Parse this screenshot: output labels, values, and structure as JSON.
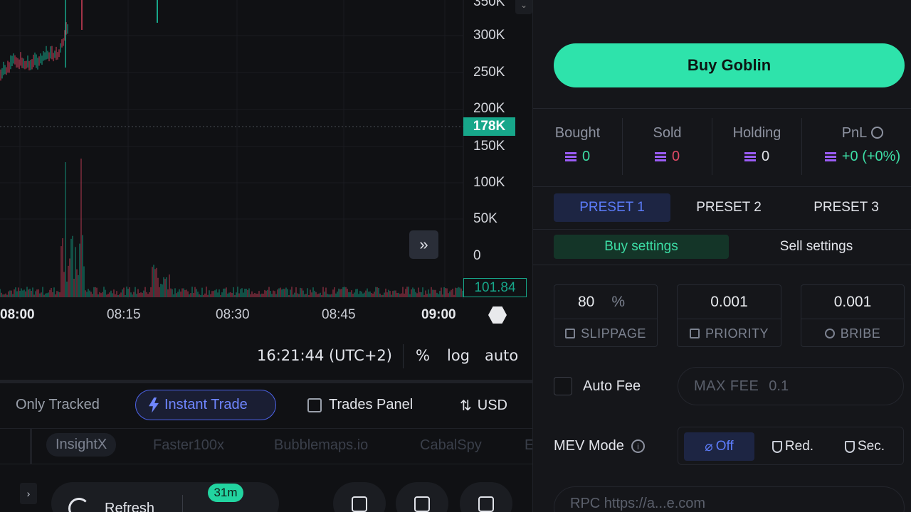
{
  "chart": {
    "price_axis": [
      "350K",
      "300K",
      "250K",
      "200K",
      "150K",
      "100K",
      "50K",
      "0"
    ],
    "current_price_badge": "178K",
    "volume_badge": "101.84",
    "time_axis": [
      {
        "label": "08:00",
        "bold": true
      },
      {
        "label": "08:15",
        "bold": false
      },
      {
        "label": "08:30",
        "bold": false
      },
      {
        "label": "08:45",
        "bold": false
      },
      {
        "label": "09:00",
        "bold": true
      }
    ],
    "scroll_glyph": "»",
    "colors": {
      "up": "#17a78a",
      "down": "#d2405a",
      "accent": "#2ee3ab"
    }
  },
  "chart_footer": {
    "clock": "16:21:44 (UTC+2)",
    "percent": "%",
    "log": "log",
    "auto": "auto"
  },
  "filters": {
    "only_tracked": "Only Tracked",
    "instant_trade": "Instant Trade",
    "trades_panel": "Trades Panel",
    "currency": "USD"
  },
  "apps": {
    "items": [
      "InsightX",
      "Faster100x",
      "Bubblemaps.io",
      "CabalSpy",
      "E"
    ]
  },
  "bottom_bar": {
    "refresh": "Refresh",
    "timer": "31m"
  },
  "trade": {
    "buy_label": "Buy Goblin",
    "stats": [
      {
        "label": "Bought",
        "value": "0",
        "color": "#3ddfa6"
      },
      {
        "label": "Sold",
        "value": "0",
        "color": "#e24a66"
      },
      {
        "label": "Holding",
        "value": "0",
        "color": "#e2e4ea"
      },
      {
        "label": "PnL",
        "value": "+0 (+0%)",
        "color": "#3ddfa6"
      }
    ],
    "presets": [
      "PRESET 1",
      "PRESET 2",
      "PRESET 3"
    ],
    "settings_tabs": [
      "Buy settings",
      "Sell settings"
    ],
    "slippage": {
      "value": "80",
      "unit": "%",
      "label": "SLIPPAGE"
    },
    "priority": {
      "value": "0.001",
      "label": "PRIORITY"
    },
    "bribe": {
      "value": "0.001",
      "label": "BRIBE"
    },
    "auto_fee": "Auto Fee",
    "max_fee_label": "MAX FEE",
    "max_fee_value": "0.1",
    "mev_label": "MEV Mode",
    "mev_options": [
      "Off",
      "Red.",
      "Sec."
    ],
    "rpc_text": "RPC  https://a...e.com"
  }
}
